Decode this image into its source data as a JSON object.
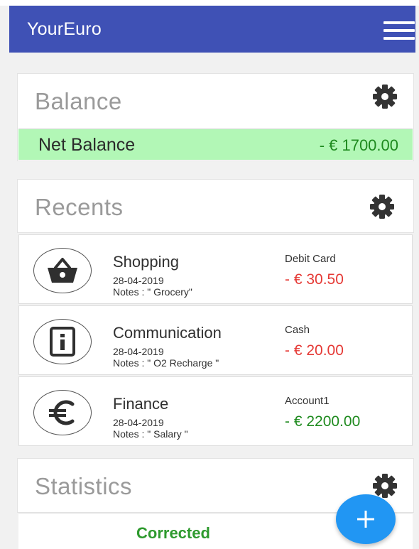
{
  "app": {
    "title": "YourEuro"
  },
  "colors": {
    "appbar": "#3f51b5",
    "net_balance_bg": "#b2f7b6",
    "negative": "#e53935",
    "positive": "#1e8a1e",
    "fab": "#2196f3"
  },
  "balance": {
    "title": "Balance",
    "net_label": "Net Balance",
    "net_value": "- € 1700.00"
  },
  "recents": {
    "title": "Recents",
    "items": [
      {
        "icon": "basket-icon",
        "category": "Shopping",
        "date": "28-04-2019",
        "notes": "Notes : \" Grocery\"",
        "account": "Debit Card",
        "amount": "- € 30.50",
        "color": "#e53935"
      },
      {
        "icon": "info-icon",
        "category": "Communication",
        "date": "28-04-2019",
        "notes": "Notes : \" O2 Recharge  \"",
        "account": "Cash",
        "amount": "- € 20.00",
        "color": "#e53935"
      },
      {
        "icon": "euro-icon",
        "category": "Finance",
        "date": "28-04-2019",
        "notes": "Notes : \" Salary  \"",
        "account": "Account1",
        "amount": "- € 2200.00",
        "color": "#1e8a1e"
      }
    ]
  },
  "statistics": {
    "title": "Statistics",
    "status": "Corrected"
  },
  "icons": {
    "menu": "hamburger-icon",
    "settings": "gear-icon",
    "add": "plus-icon"
  }
}
